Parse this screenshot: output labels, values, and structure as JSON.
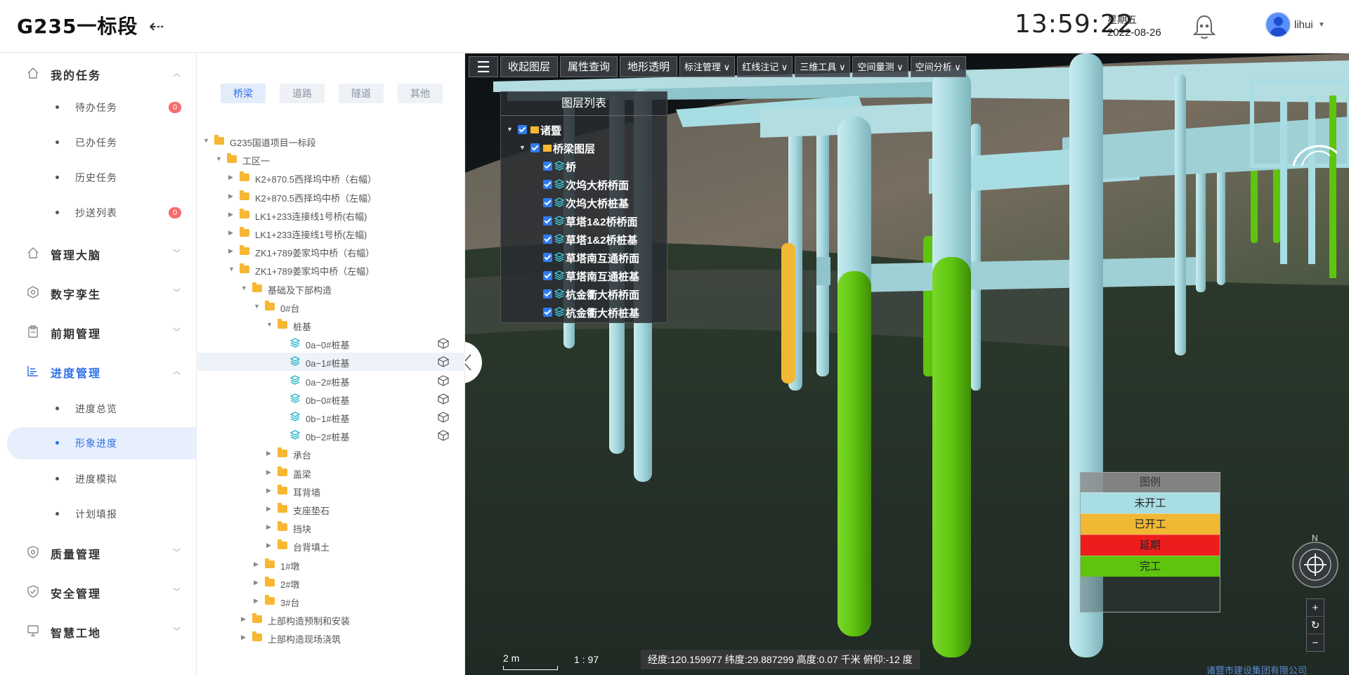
{
  "header": {
    "logo": "G235一标段",
    "time": "13:59:22",
    "weekday": "星期五",
    "date": "2022-08-26",
    "username": "lihui"
  },
  "sidebar": {
    "groups": [
      {
        "label": "我的任务",
        "icon": "home-icon",
        "expanded": true
      },
      {
        "label": "管理大脑",
        "icon": "home-icon",
        "expanded": false
      },
      {
        "label": "数字孪生",
        "icon": "hexagon-icon",
        "expanded": false
      },
      {
        "label": "前期管理",
        "icon": "clipboard-icon",
        "expanded": false
      },
      {
        "label": "进度管理",
        "icon": "list-icon",
        "expanded": true
      },
      {
        "label": "质量管理",
        "icon": "shield-icon",
        "expanded": false
      },
      {
        "label": "安全管理",
        "icon": "shield-check-icon",
        "expanded": false
      },
      {
        "label": "智慧工地",
        "icon": "monitor-icon",
        "expanded": false
      }
    ],
    "tasks": [
      {
        "label": "待办任务",
        "badge": "0"
      },
      {
        "label": "已办任务"
      },
      {
        "label": "历史任务"
      },
      {
        "label": "抄送列表",
        "badge": "0"
      }
    ],
    "progress": [
      {
        "label": "进度总览"
      },
      {
        "label": "形象进度"
      },
      {
        "label": "进度模拟"
      },
      {
        "label": "计划填报"
      }
    ]
  },
  "tabs": [
    "桥梁",
    "道路",
    "隧道",
    "其他"
  ],
  "tree": [
    "G235国道项目一标段",
    "工区一",
    "K2+870.5西择坞中桥（右幅）",
    "K2+870.5西择坞中桥（左幅）",
    "LK1+233连接线1号桥(右幅)",
    "LK1+233连接线1号桥(左幅)",
    "ZK1+789姜家坞中桥（右幅）",
    "ZK1+789姜家坞中桥（左幅）",
    "基础及下部构造",
    "0#台",
    "桩基",
    "0a−0#桩基",
    "0a−1#桩基",
    "0a−2#桩基",
    "0b−0#桩基",
    "0b−1#桩基",
    "0b−2#桩基",
    "承台",
    "盖梁",
    "耳背墙",
    "支座垫石",
    "挡块",
    "台背填土",
    "1#墩",
    "2#墩",
    "3#台",
    "上部构造预制和安装",
    "上部构造现场浇筑"
  ],
  "toolbar": [
    "收起图层",
    "属性查询",
    "地形透明",
    "标注管理 ∨",
    "红线注记 ∨",
    "三维工具 ∨",
    "空间量测 ∨",
    "空间分析 ∨"
  ],
  "layer_panel": {
    "title": "图层列表",
    "items": [
      "诸暨",
      "桥梁图层",
      "桥",
      "次坞大桥桥面",
      "次坞大桥桩基",
      "草塔1&2桥桥面",
      "草塔1&2桥桩基",
      "草塔南互通桥面",
      "草塔南互通桩基",
      "杭金衢大桥桥面",
      "杭金衢大桥桩基"
    ]
  },
  "legend": {
    "title": "图例",
    "items": [
      {
        "label": "未开工",
        "color": "#a9dde4"
      },
      {
        "label": "已开工",
        "color": "#f0b833"
      },
      {
        "label": "延期",
        "color": "#ee1c1c"
      },
      {
        "label": "完工",
        "color": "#5ec40e"
      }
    ]
  },
  "map": {
    "scale_label": "2 m",
    "ratio": "1 : 97",
    "coords": "经度:120.159977  纬度:29.887299  高度:0.07 千米  俯仰:-12 度",
    "compass_label": "N",
    "zoom": [
      "+",
      "↻",
      "−"
    ],
    "company": "诸暨市建设集团有限公司"
  },
  "colors": {
    "accent": "#2f6fe8",
    "pier": "#a9dde4",
    "done": "#5ec40e",
    "started": "#f0b833",
    "delayed": "#ee1c1c"
  }
}
